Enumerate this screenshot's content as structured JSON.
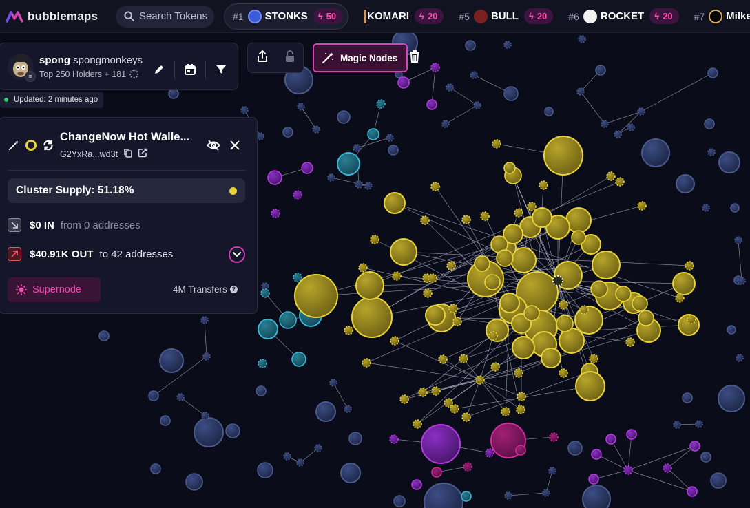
{
  "app": {
    "name": "bubblemaps",
    "search_placeholder": "Search Tokens"
  },
  "trending": [
    {
      "rank": "#1",
      "name": "STONKS",
      "boost": "50",
      "icon_color": "#3b5bd9"
    },
    {
      "rank": "",
      "name": "KOMARI",
      "boost": "20",
      "icon_color": "#c79b6a"
    },
    {
      "rank": "#5",
      "name": "BULL",
      "boost": "20",
      "icon_color": "#7a2020"
    },
    {
      "rank": "#6",
      "name": "ROCKET",
      "boost": "20",
      "icon_color": "#ffffff"
    },
    {
      "rank": "#7",
      "name": "Milker",
      "boost": "",
      "icon_color": "#d6a65a"
    }
  ],
  "user": {
    "nickname": "spong",
    "handle": "spongmonkeys",
    "holders_text": "Top 250 Holders + 181",
    "updated_text": "Updated: 2 minutes ago"
  },
  "toolbar": {
    "magic_nodes_label": "Magic Nodes"
  },
  "detail": {
    "title": "ChangeNow Hot Walle...",
    "address": "G2YxRa...wd3t",
    "cluster_supply": "Cluster Supply: 51.18%",
    "in_amount": "$0 IN",
    "in_rest": "from 0 addresses",
    "out_amount": "$40.91K OUT",
    "out_rest": "to 42 addresses",
    "supernode_label": "Supernode",
    "transfers": "4M Transfers"
  },
  "colors": {
    "accent_pink": "#d745b8",
    "cluster_yellow": "#e8d43a",
    "node_blue": "#2a3a66",
    "node_cyan": "#36b8d4",
    "node_purple": "#b33ee0",
    "status_green": "#2fd16a",
    "background": "#0b0c1a"
  }
}
